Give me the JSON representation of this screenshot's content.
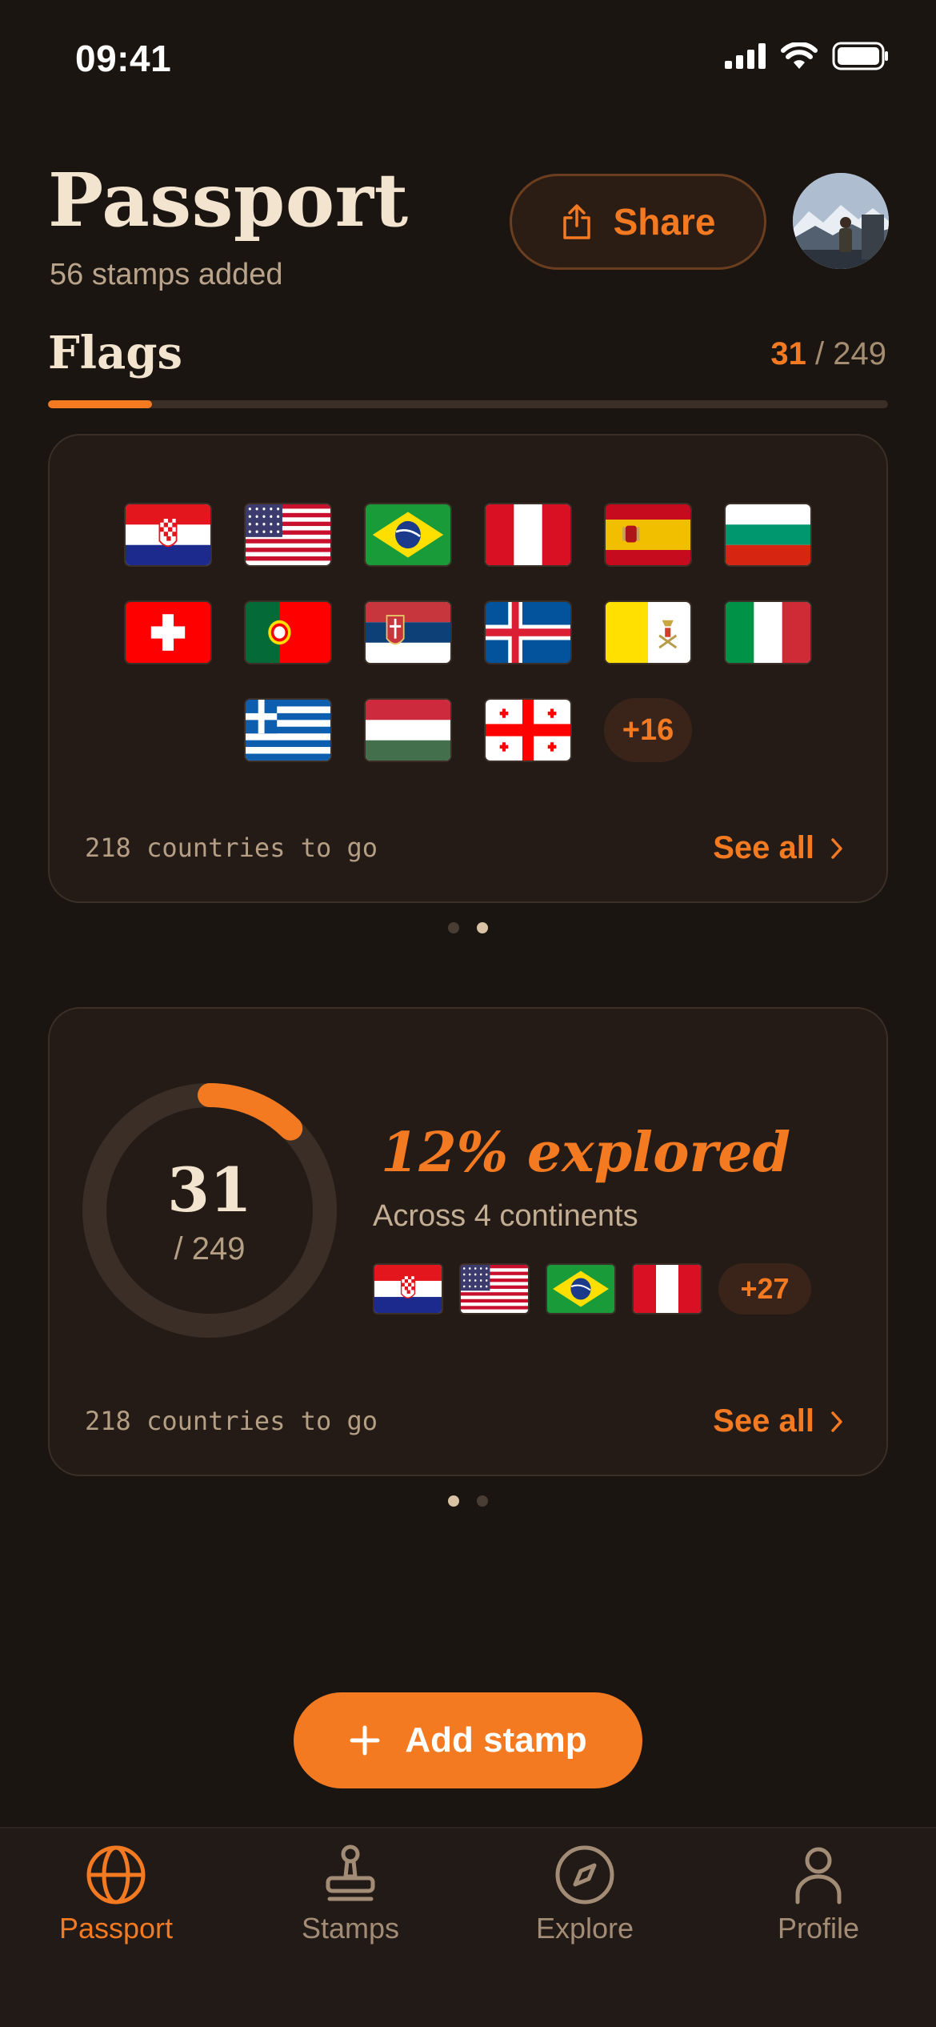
{
  "status": {
    "time": "09:41"
  },
  "header": {
    "title": "Passport",
    "subtitle": "56 stamps added",
    "share_label": "Share"
  },
  "flags_section": {
    "title": "Flags",
    "collected": "31",
    "separator": " / ",
    "total": "249",
    "progress_fraction": 0.124
  },
  "flags_card": {
    "rows": [
      [
        "croatia",
        "usa",
        "brazil",
        "peru",
        "spain",
        "bulgaria"
      ],
      [
        "switzerland",
        "portugal",
        "serbia",
        "iceland",
        "vatican",
        "italy"
      ],
      [
        "greece",
        "hungary",
        "georgia"
      ]
    ],
    "more_label": "+16",
    "remaining_num": "218",
    "remaining_text": "countries to go",
    "see_all": "See all",
    "page_dots": {
      "count": 2,
      "active": 1
    }
  },
  "stats_card": {
    "count": "31",
    "total": "/ 249",
    "explored_fraction": 0.124,
    "explored_label": "12% explored",
    "continents_label": "Across 4 continents",
    "mini_flags": [
      "croatia",
      "usa",
      "brazil",
      "peru"
    ],
    "more_label": "+27",
    "remaining_num": "218",
    "remaining_text": "countries to go",
    "see_all": "See all",
    "page_dots": {
      "count": 2,
      "active": 0
    }
  },
  "add_stamp_label": "Add stamp",
  "tabs": [
    {
      "label": "Passport",
      "icon": "globe-icon",
      "active": true
    },
    {
      "label": "Stamps",
      "icon": "stamp-icon",
      "active": false
    },
    {
      "label": "Explore",
      "icon": "compass-icon",
      "active": false
    },
    {
      "label": "Profile",
      "icon": "person-icon",
      "active": false
    }
  ],
  "colors": {
    "accent": "#f47a22",
    "background": "#1b1512",
    "card": "#241b16",
    "text_primary": "#f2e4cf",
    "text_muted": "#b49e84"
  }
}
